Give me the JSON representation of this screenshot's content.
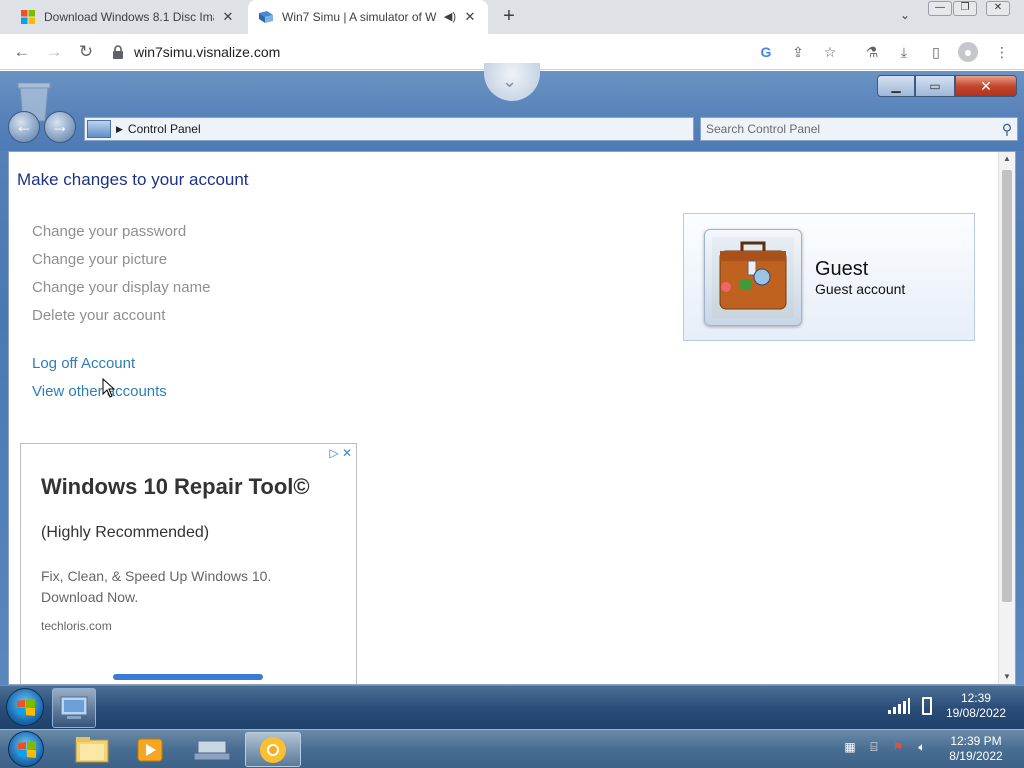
{
  "browser": {
    "tabs": [
      {
        "title": "Download Windows 8.1 Disc Ima",
        "close": "✕"
      },
      {
        "title": "Win7 Simu | A simulator of W",
        "close": "✕"
      }
    ],
    "new_tab": "+",
    "url": "win7simu.visnalize.com"
  },
  "window": {
    "breadcrumb": "Control Panel",
    "search_placeholder": "Search Control Panel"
  },
  "content": {
    "heading": "Make changes to your account",
    "tasks": [
      "Change your password",
      "Change your picture",
      "Change your display name",
      "Delete your account"
    ],
    "links": [
      "Log off Account",
      "View other accounts"
    ],
    "user": {
      "name": "Guest",
      "type": "Guest account"
    }
  },
  "ad": {
    "title": "Windows 10 Repair Tool©",
    "subtitle": "(Highly Recommended)",
    "body": "Fix, Clean, & Speed Up Windows 10. Download Now.",
    "domain": "techloris.com"
  },
  "taskbar_inner": {
    "time": "12:39",
    "date": "19/08/2022"
  },
  "taskbar_host": {
    "time": "12:39 PM",
    "date": "8/19/2022"
  }
}
